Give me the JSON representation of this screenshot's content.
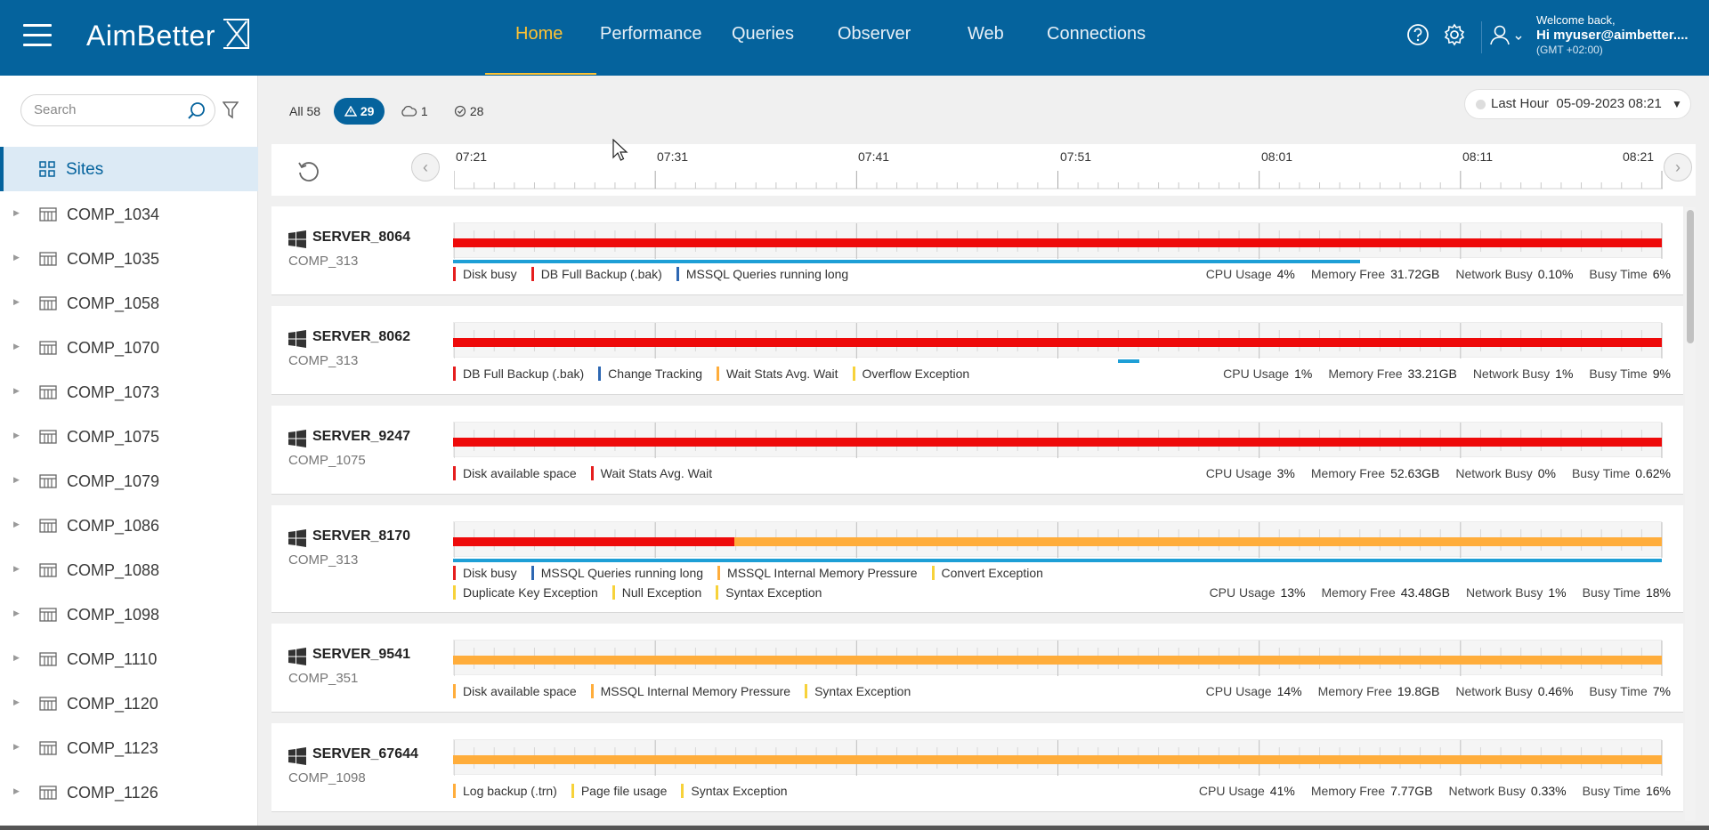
{
  "app": {
    "brand": "AimBetter",
    "nav": [
      "Home",
      "Performance",
      "Queries",
      "Observer",
      "Web",
      "Connections"
    ],
    "active_nav": "Home",
    "icons": [
      "menu-icon",
      "help-icon",
      "settings-icon",
      "user-icon"
    ],
    "welcome": "Welcome back,",
    "user": "Hi myuser@aimbetter....",
    "timezone": "(GMT +02:00)",
    "accent_color": "#05639d",
    "active_color": "#ffc233"
  },
  "sidebar": {
    "search_placeholder": "Search",
    "sites_label": "Sites",
    "companies": [
      "COMP_1034",
      "COMP_1035",
      "COMP_1058",
      "COMP_1070",
      "COMP_1073",
      "COMP_1075",
      "COMP_1079",
      "COMP_1086",
      "COMP_1088",
      "COMP_1098",
      "COMP_1110",
      "COMP_1120",
      "COMP_1123",
      "COMP_1126"
    ]
  },
  "filters": {
    "all": "All 58",
    "alerts": "29",
    "cloud": "1",
    "ok": "28"
  },
  "range": {
    "label": "Last Hour",
    "datetime": "05-09-2023 08:21"
  },
  "timeline": {
    "ticks": [
      "07:21",
      "07:31",
      "07:41",
      "07:51",
      "08:01",
      "08:11",
      "08:21"
    ]
  },
  "servers": [
    {
      "name": "SERVER_8064",
      "company": "COMP_313",
      "status_segments": [
        {
          "color": "#ee0a0a",
          "from": 0,
          "to": 1
        }
      ],
      "sub_segments": [
        {
          "from": 0,
          "to": 0.75
        }
      ],
      "alerts": [
        {
          "label": "Disk busy",
          "color": "red"
        },
        {
          "label": "DB Full Backup (.bak)",
          "color": "red"
        },
        {
          "label": "MSSQL Queries running long",
          "color": "blue"
        }
      ],
      "metrics": {
        "cpu": "4%",
        "memory": "31.72GB",
        "network": "0.10%",
        "busy": "6%"
      }
    },
    {
      "name": "SERVER_8062",
      "company": "COMP_313",
      "status_segments": [
        {
          "color": "#ee0a0a",
          "from": 0,
          "to": 1
        }
      ],
      "sub_segments": [
        {
          "from": 0.55,
          "to": 0.568
        }
      ],
      "alerts": [
        {
          "label": "DB Full Backup (.bak)",
          "color": "red"
        },
        {
          "label": "Change Tracking",
          "color": "blue"
        },
        {
          "label": "Wait Stats Avg. Wait",
          "color": "orange"
        },
        {
          "label": "Overflow Exception",
          "color": "yellow"
        }
      ],
      "metrics": {
        "cpu": "1%",
        "memory": "33.21GB",
        "network": "1%",
        "busy": "9%"
      }
    },
    {
      "name": "SERVER_9247",
      "company": "COMP_1075",
      "status_segments": [
        {
          "color": "#ee0a0a",
          "from": 0,
          "to": 1
        }
      ],
      "sub_segments": [],
      "alerts": [
        {
          "label": "Disk available space",
          "color": "red"
        },
        {
          "label": "Wait Stats Avg. Wait",
          "color": "red"
        }
      ],
      "metrics": {
        "cpu": "3%",
        "memory": "52.63GB",
        "network": "0%",
        "busy": "0.62%"
      }
    },
    {
      "name": "SERVER_8170",
      "company": "COMP_313",
      "status_segments": [
        {
          "color": "#ee0a0a",
          "from": 0,
          "to": 0.233
        },
        {
          "color": "#ffad3b",
          "from": 0.233,
          "to": 1
        }
      ],
      "sub_segments": [
        {
          "from": 0,
          "to": 1
        }
      ],
      "alerts": [
        {
          "label": "Disk busy",
          "color": "red"
        },
        {
          "label": "MSSQL Queries running long",
          "color": "blue"
        },
        {
          "label": "MSSQL Internal Memory Pressure",
          "color": "orange"
        },
        {
          "label": "Convert Exception",
          "color": "yellow"
        },
        {
          "label": "Duplicate Key Exception",
          "color": "yellow"
        },
        {
          "label": "Null Exception",
          "color": "yellow"
        },
        {
          "label": "Syntax Exception",
          "color": "yellow"
        }
      ],
      "metrics": {
        "cpu": "13%",
        "memory": "43.48GB",
        "network": "1%",
        "busy": "18%"
      }
    },
    {
      "name": "SERVER_9541",
      "company": "COMP_351",
      "status_segments": [
        {
          "color": "#ffad3b",
          "from": 0,
          "to": 1
        }
      ],
      "sub_segments": [],
      "alerts": [
        {
          "label": "Disk available space",
          "color": "orange"
        },
        {
          "label": "MSSQL Internal Memory Pressure",
          "color": "orange"
        },
        {
          "label": "Syntax Exception",
          "color": "yellow"
        }
      ],
      "metrics": {
        "cpu": "14%",
        "memory": "19.8GB",
        "network": "0.46%",
        "busy": "7%"
      }
    },
    {
      "name": "SERVER_67644",
      "company": "COMP_1098",
      "status_segments": [
        {
          "color": "#ffad3b",
          "from": 0,
          "to": 1
        }
      ],
      "sub_segments": [],
      "alerts": [
        {
          "label": "Log backup (.trn)",
          "color": "orange"
        },
        {
          "label": "Page file usage",
          "color": "yellow"
        },
        {
          "label": "Syntax Exception",
          "color": "yellow"
        }
      ],
      "metrics": {
        "cpu": "41%",
        "memory": "7.77GB",
        "network": "0.33%",
        "busy": "16%"
      }
    }
  ],
  "metric_labels": {
    "cpu": "CPU Usage",
    "memory": "Memory Free",
    "network": "Network Busy",
    "busy": "Busy Time"
  }
}
